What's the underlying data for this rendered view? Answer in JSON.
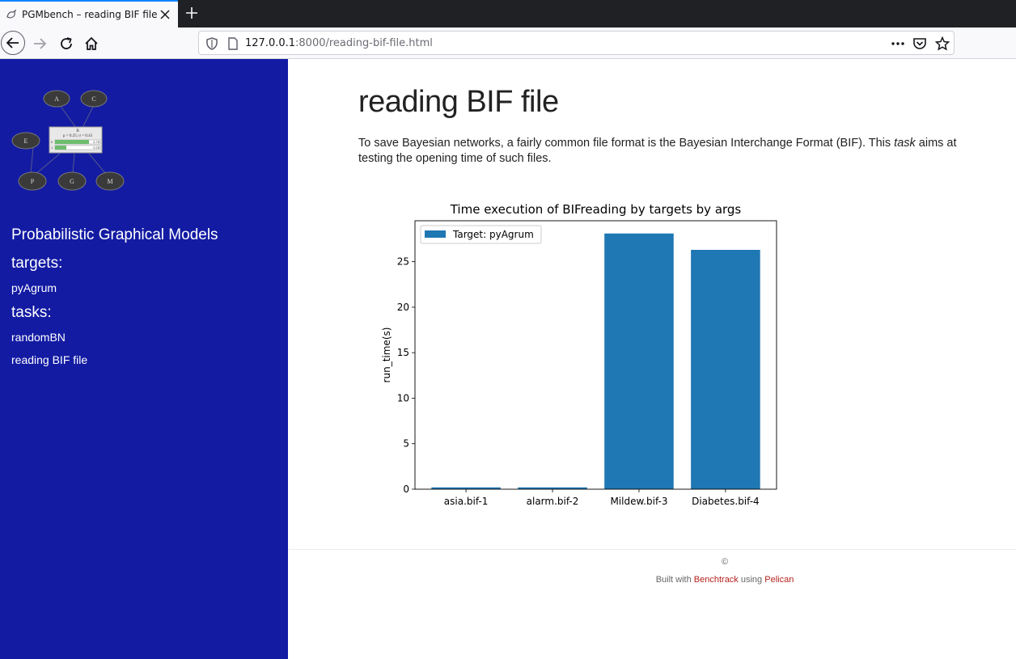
{
  "browser": {
    "tab_title": "PGMbench – reading BIF file",
    "url_host": "127.0.0.1",
    "url_rest": ":8000/reading-bif-file.html"
  },
  "sidebar": {
    "logo_nodes": [
      "A",
      "C",
      "E",
      "P",
      "G",
      "M"
    ],
    "logo_center_label": "B",
    "logo_center_stats": "μ = 0.25; σ = 0.43",
    "logo_bar_labels": [
      "0",
      "1"
    ],
    "logo_bar_values": [
      "0.75",
      "0.25"
    ],
    "site_title": "Probabilistic Graphical Models",
    "targets_heading": "targets:",
    "targets": [
      "pyAgrum"
    ],
    "tasks_heading": "tasks:",
    "tasks": [
      "randomBN",
      "reading BIF file"
    ]
  },
  "main": {
    "title": "reading BIF file",
    "intro_before": "To save Bayesian networks, a fairly common file format is the Bayesian Interchange Format (BIF). This ",
    "intro_em": "task",
    "intro_after": " aims at testing the opening time of such files."
  },
  "chart_data": {
    "type": "bar",
    "title": "Time execution of BIFreading by targets by args",
    "xlabel": "",
    "ylabel": "run_time(s)",
    "categories": [
      "asia.bif-1",
      "alarm.bif-2",
      "Mildew.bif-3",
      "Diabetes.bif-4"
    ],
    "series": [
      {
        "name": "Target: pyAgrum",
        "values": [
          0.2,
          0.2,
          28.1,
          26.3
        ],
        "color": "#1f77b4"
      }
    ],
    "ylim": [
      0,
      29.5
    ],
    "yticks": [
      0,
      5,
      10,
      15,
      20,
      25
    ],
    "legend": "top-left",
    "grid": false
  },
  "footer": {
    "copyright": "©",
    "built_prefix": "Built with",
    "built_link1": "Benchtrack",
    "built_middle": "using",
    "built_link2": "Pelican"
  }
}
